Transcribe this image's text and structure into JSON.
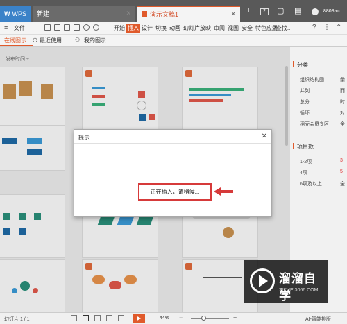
{
  "titlebar": {
    "tabs": [
      {
        "label": "WPS"
      },
      {
        "label": "新建"
      },
      {
        "label": "演示文稿1"
      }
    ],
    "add_tab": "+",
    "badge": "2",
    "user": "8808-rc"
  },
  "menubar": {
    "file": "文件",
    "tabs": [
      "开始",
      "插入",
      "设计",
      "切换",
      "动画",
      "幻灯片放映",
      "审阅",
      "视图",
      "安全",
      "特色应用"
    ],
    "active_tab": "插入",
    "search": "查找...",
    "help": "?"
  },
  "subtabs": {
    "online": "在线图示",
    "recent": "最近使用",
    "mine": "我的图示",
    "sort": "发布时间 ÷"
  },
  "right_panel": {
    "category_title": "分类",
    "categories": [
      {
        "left": "组织结构图",
        "right": "彙"
      },
      {
        "left": "并列",
        "right": "而"
      },
      {
        "left": "总分",
        "right": "时"
      },
      {
        "left": "循环",
        "right": "对"
      },
      {
        "left": "稻壳会员专区",
        "right": "全"
      }
    ],
    "count_title": "项目数",
    "counts": [
      {
        "left": "1-2项",
        "right": "3"
      },
      {
        "left": "4项",
        "right": "5"
      },
      {
        "left": "6项及以上",
        "right": "全"
      }
    ]
  },
  "dialog": {
    "title": "提示",
    "close": "✕",
    "message": "正在插入，请稍候..."
  },
  "statusbar": {
    "slide": "幻灯片 1 / 1",
    "zoom": "44%",
    "ai": "AI-智能排版"
  },
  "watermark": {
    "name": "溜溜自学",
    "url": "ZIXUE.3066.COM"
  },
  "colors": {
    "accent": "#e05a2b",
    "highlight_box": "#d63a3a"
  }
}
